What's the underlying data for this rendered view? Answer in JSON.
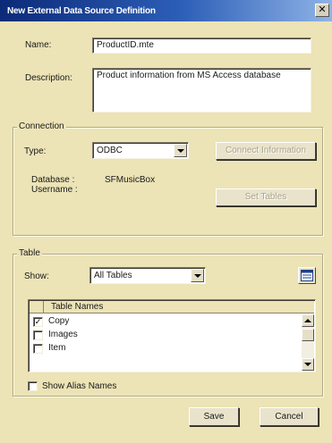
{
  "window": {
    "title": "New External Data Source Definition",
    "close_glyph": "✕"
  },
  "fields": {
    "name_label": "Name:",
    "name_value": "ProductID.mte",
    "description_label": "Description:",
    "description_value": "Product information from MS Access database"
  },
  "connection": {
    "group_title": "Connection",
    "type_label": "Type:",
    "type_value": "ODBC",
    "connect_button": "Connect Information",
    "database_label": "Database :",
    "database_value": "SFMusicBox",
    "username_label": "Username :",
    "set_tables_button": "Set Tables"
  },
  "table": {
    "group_title": "Table",
    "show_label": "Show:",
    "show_value": "All Tables",
    "refresh_icon": "table-view-icon",
    "column_header": "Table Names",
    "rows": [
      {
        "name": "Copy",
        "checked": true,
        "mark": "✓"
      },
      {
        "name": "Images",
        "checked": false,
        "mark": ""
      },
      {
        "name": "Item",
        "checked": false,
        "mark": ""
      }
    ],
    "show_alias_label": "Show Alias Names"
  },
  "footer": {
    "save_button": "Save",
    "cancel_button": "Cancel"
  }
}
